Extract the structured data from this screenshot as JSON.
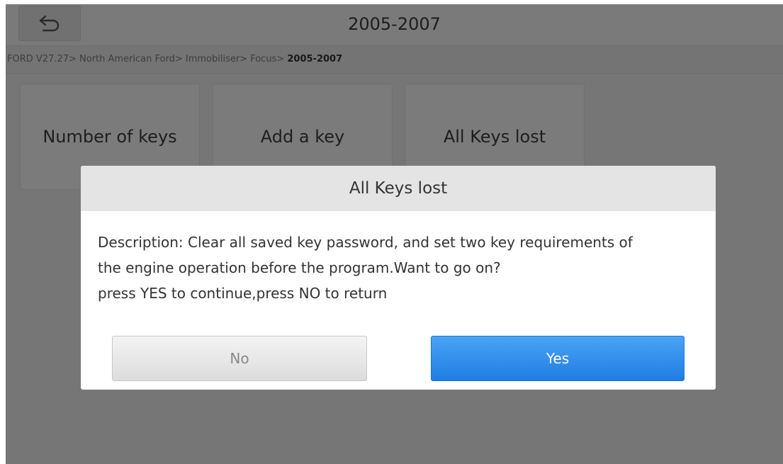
{
  "header": {
    "title": "2005-2007",
    "back_icon": "back-arrow-icon"
  },
  "breadcrumb": {
    "path": "FORD V27.27> North American Ford> Immobiliser> Focus> ",
    "current": "2005-2007"
  },
  "tiles": [
    {
      "label": "Number of keys"
    },
    {
      "label": "Add a key"
    },
    {
      "label": "All Keys lost"
    }
  ],
  "dialog": {
    "title": "All Keys lost",
    "line1": "Description: Clear all saved key password, and set two key requirements of",
    "line2": "the engine operation before the program.Want to go on?",
    "line3": "press YES to continue,press NO to return",
    "no_label": "No",
    "yes_label": "Yes"
  },
  "colors": {
    "accent": "#2a8cf0",
    "overlay": "#000000"
  }
}
